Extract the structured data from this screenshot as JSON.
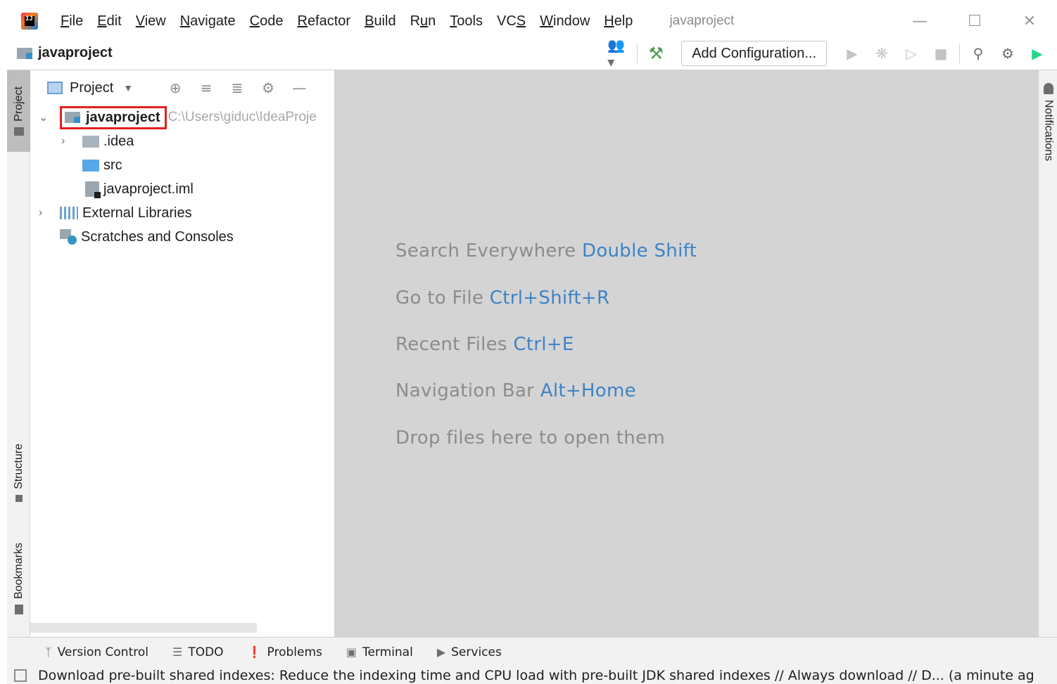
{
  "menubar": {
    "items": [
      {
        "pre": "",
        "ul": "F",
        "post": "ile"
      },
      {
        "pre": "",
        "ul": "E",
        "post": "dit"
      },
      {
        "pre": "",
        "ul": "V",
        "post": "iew"
      },
      {
        "pre": "",
        "ul": "N",
        "post": "avigate"
      },
      {
        "pre": "",
        "ul": "C",
        "post": "ode"
      },
      {
        "pre": "",
        "ul": "R",
        "post": "efactor"
      },
      {
        "pre": "",
        "ul": "B",
        "post": "uild"
      },
      {
        "pre": "R",
        "ul": "u",
        "post": "n"
      },
      {
        "pre": "",
        "ul": "T",
        "post": "ools"
      },
      {
        "pre": "VC",
        "ul": "S",
        "post": ""
      },
      {
        "pre": "",
        "ul": "W",
        "post": "indow"
      },
      {
        "pre": "",
        "ul": "H",
        "post": "elp"
      }
    ]
  },
  "window": {
    "title": "javaproject",
    "minimize": "—",
    "maximize": "☐",
    "close": "✕"
  },
  "toolbar": {
    "breadcrumb": "javaproject",
    "add_config": "Add Configuration..."
  },
  "left_strip": {
    "project": "Project",
    "structure": "Structure",
    "bookmarks": "Bookmarks"
  },
  "project_panel": {
    "title": "Project"
  },
  "tree": {
    "root": {
      "label": "javaproject",
      "path": "C:\\Users\\giduc\\IdeaProje"
    },
    "idea": ".idea",
    "src": "src",
    "iml": "javaproject.iml",
    "libs": "External Libraries",
    "scratches": "Scratches and Consoles"
  },
  "editor": {
    "hints": [
      {
        "text": "Search Everywhere ",
        "key": "Double Shift"
      },
      {
        "text": "Go to File ",
        "key": "Ctrl+Shift+R"
      },
      {
        "text": "Recent Files ",
        "key": "Ctrl+E"
      },
      {
        "text": "Navigation Bar ",
        "key": "Alt+Home"
      },
      {
        "text": "Drop files here to open them",
        "key": ""
      }
    ]
  },
  "right_strip": {
    "notifications": "Notifications"
  },
  "bottom_tabs": [
    {
      "label": "Version Control",
      "icon": "branch-icon"
    },
    {
      "label": "TODO",
      "icon": "list-icon"
    },
    {
      "label": "Problems",
      "icon": "alert-icon"
    },
    {
      "label": "Terminal",
      "icon": "terminal-icon"
    },
    {
      "label": "Services",
      "icon": "services-icon"
    }
  ],
  "status": {
    "message": "Download pre-built shared indexes: Reduce the indexing time and CPU load with pre-built JDK shared indexes // Always download // D... (a minute ag"
  },
  "colors": {
    "accent_link": "#3d84c6",
    "highlight_box": "#e0211d",
    "editor_bg": "#d4d4d4"
  }
}
